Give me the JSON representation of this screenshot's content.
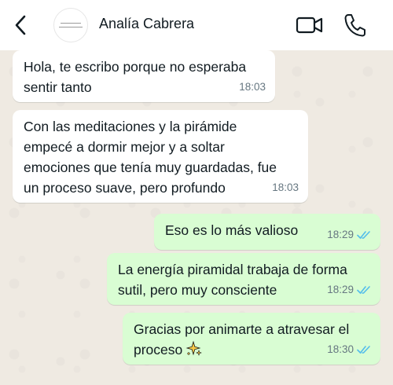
{
  "header": {
    "contact_name": "Analía Cabrera",
    "back_icon": "chevron-left-icon",
    "video_icon": "video-camera-icon",
    "call_icon": "phone-icon"
  },
  "messages": [
    {
      "direction": "incoming",
      "text": "Hola, te escribo porque no esperaba\nsentir tanto",
      "time": "18:03"
    },
    {
      "direction": "incoming",
      "text": "Con las meditaciones y la pirámide\nempecé a dormir mejor y a soltar\nemociones que tenía muy guardadas, fue\nun proceso suave, pero profundo",
      "time": "18:03"
    },
    {
      "direction": "outgoing",
      "text": "Eso es lo más valioso",
      "time": "18:29",
      "status": "read"
    },
    {
      "direction": "outgoing",
      "text": "La energía piramidal trabaja de forma\nsutil, pero muy consciente",
      "time": "18:29",
      "status": "read"
    },
    {
      "direction": "outgoing",
      "text": "Gracias por animarte a atravesar el\nproceso",
      "emoji": "sparkles-icon",
      "time": "18:30",
      "status": "read"
    }
  ],
  "colors": {
    "chat_background": "#efeae2",
    "incoming_bubble": "#ffffff",
    "outgoing_bubble": "#d9fdd3",
    "read_ticks": "#53bdeb"
  }
}
